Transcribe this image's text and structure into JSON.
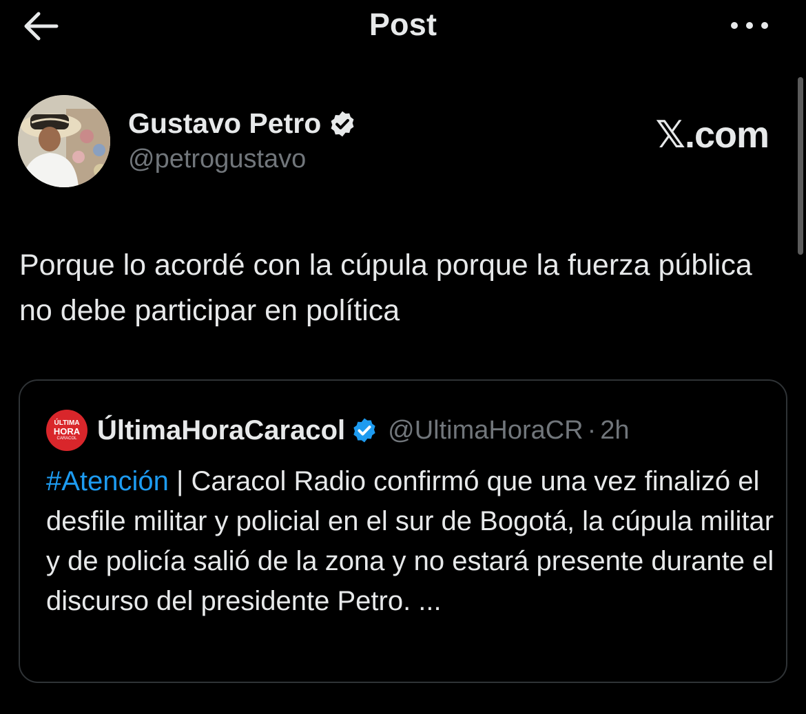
{
  "header": {
    "title": "Post",
    "back_icon": "arrow-left-icon",
    "more_icon": "more-horizontal-icon"
  },
  "author": {
    "name": "Gustavo Petro",
    "handle": "@petrogustavo",
    "verified": true,
    "verified_color": "#1d9bf0"
  },
  "watermark": {
    "text": "𝕏.com"
  },
  "post": {
    "text": "Porque lo acordé con la cúpula porque la fuerza pública no debe participar en política"
  },
  "quote": {
    "avatar_lines": [
      "ÚLTIMA",
      "HORA",
      "CARACOL"
    ],
    "name": "ÚltimaHoraCaracol",
    "handle": "@UltimaHoraCR",
    "separator": "·",
    "time": "2h",
    "hashtag": "#Atención",
    "text": " | Caracol Radio confirmó que una vez finalizó el desfile militar y policial en el sur de Bogotá, la cúpula militar y de policía salió de la zona y no estará presente durante el discurso del presidente Petro. ..."
  },
  "colors": {
    "background": "#000000",
    "text": "#e7e9ea",
    "muted": "#71767b",
    "accent": "#1d9bf0",
    "border": "#2f3336",
    "quote_avatar_bg": "#d9262b"
  }
}
